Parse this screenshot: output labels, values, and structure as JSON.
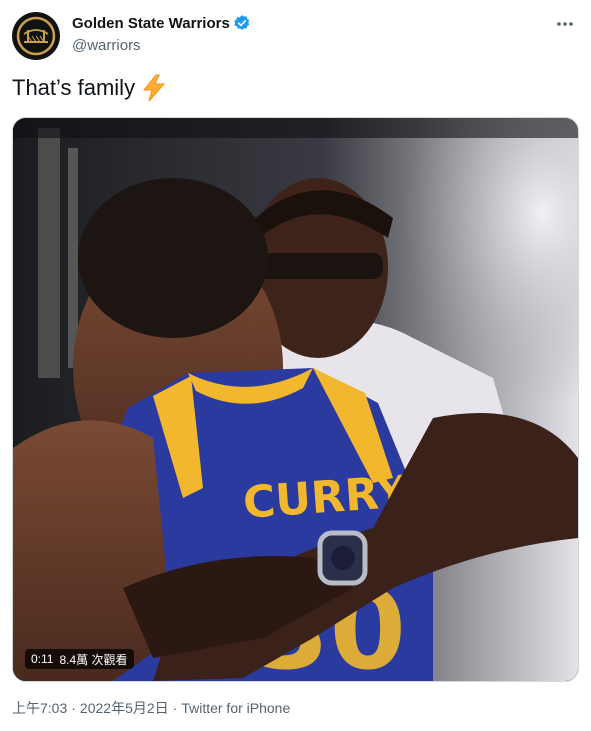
{
  "tweet": {
    "display_name": "Golden State Warriors",
    "handle": "@warriors",
    "text": "That’s family",
    "emoji_icon": "lightning-bolt-icon",
    "verified_icon": "verified-badge-icon",
    "more_icon": "more-horizontal-icon"
  },
  "video": {
    "duration": "0:11",
    "views": "8.4萬 次觀看"
  },
  "meta": {
    "time": "上午7:03",
    "separator": "·",
    "date": "2022年5月2日",
    "source": "Twitter for iPhone"
  },
  "colors": {
    "verified_blue": "#1d9bf0",
    "secondary_text": "#536471",
    "jersey_blue": "#2b3a9e",
    "jersey_gold": "#f1b82d"
  }
}
